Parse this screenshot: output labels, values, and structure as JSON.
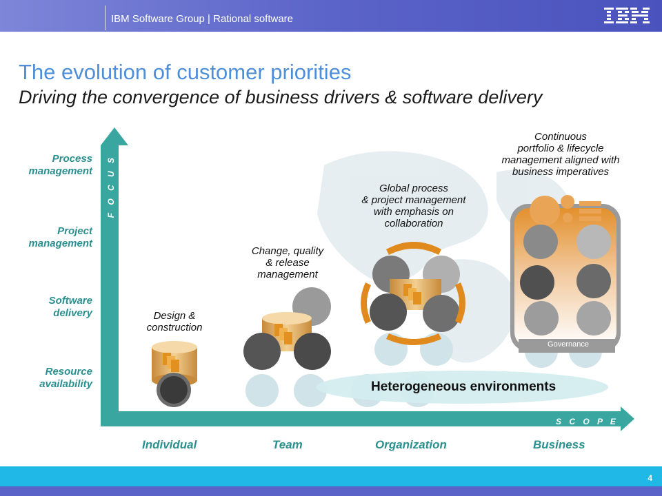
{
  "header": {
    "text": "IBM Software Group | Rational software",
    "logo": "IBM"
  },
  "title": "The evolution of customer priorities",
  "subtitle": "Driving the convergence of business drivers & software delivery",
  "axes": {
    "y_word": "F O C U S",
    "x_word": "S C O P E"
  },
  "y_labels": [
    {
      "line1": "Process",
      "line2": "management"
    },
    {
      "line1": "Project",
      "line2": "management"
    },
    {
      "line1": "Software",
      "line2": "delivery"
    },
    {
      "line1": "Resource",
      "line2": "availability"
    }
  ],
  "x_labels": [
    "Individual",
    "Team",
    "Organization",
    "Business"
  ],
  "captions": {
    "individual": [
      "Design &",
      "construction"
    ],
    "team": [
      "Change, quality",
      "& release",
      "management"
    ],
    "organization": [
      "Global process",
      "& project management",
      "with emphasis on",
      "collaboration"
    ],
    "business": [
      "Continuous",
      "portfolio & lifecycle",
      "management aligned with",
      "business imperatives"
    ]
  },
  "heterogeneous": "Heterogeneous environments",
  "governance": "Governance",
  "page_number": "4",
  "colors": {
    "teal": "#3aa6a0",
    "title_blue": "#4f8fd8",
    "header_blue": "#5b64c8",
    "footer_cyan": "#20b8e6",
    "orange": "#e08a1e"
  }
}
